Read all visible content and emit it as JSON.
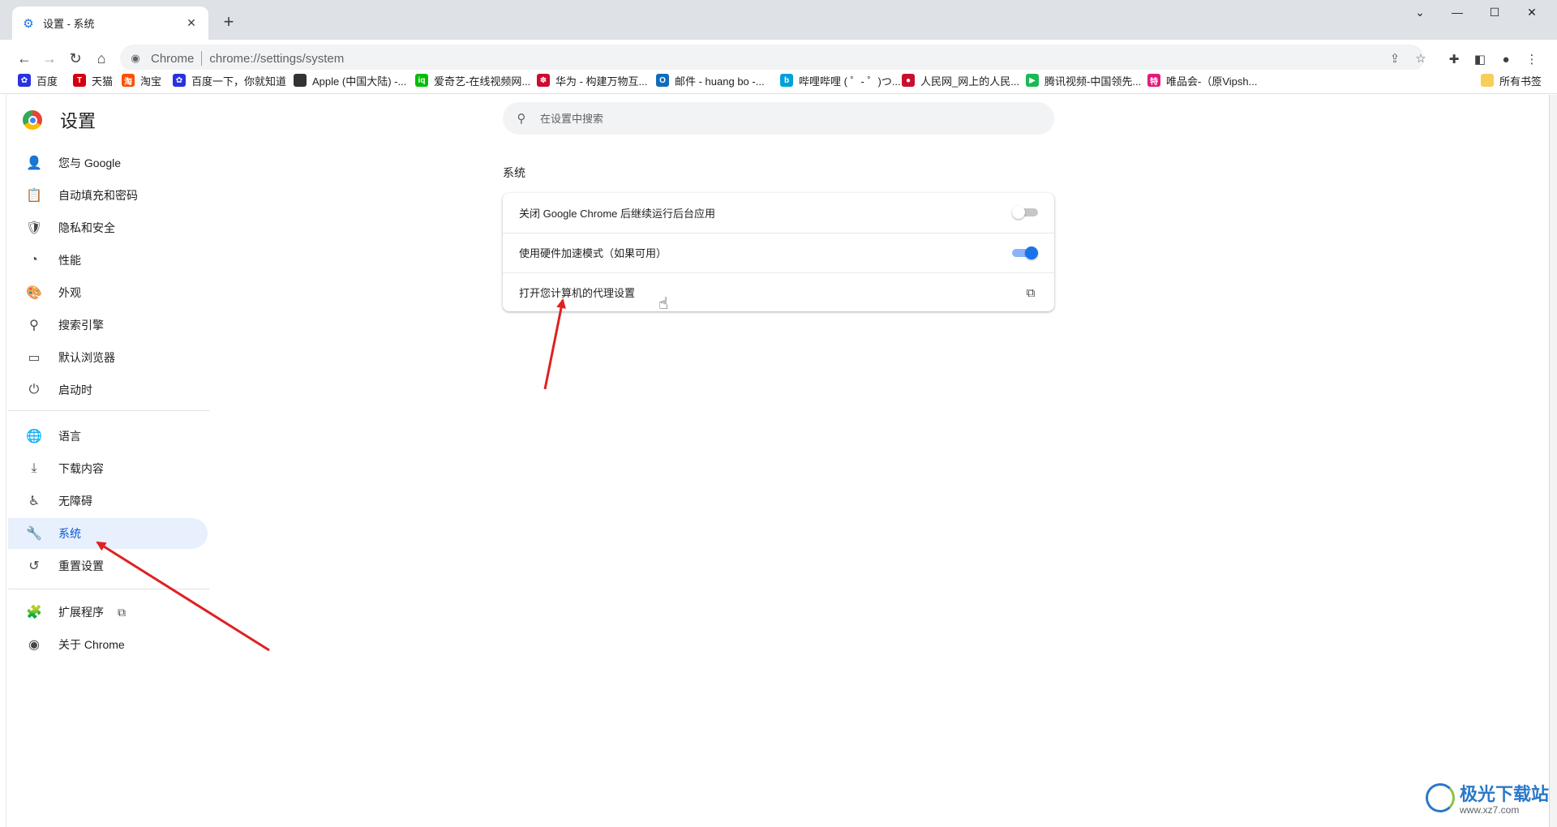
{
  "browser": {
    "tab_title": "设置 - 系统",
    "new_tab": "+",
    "omnibox_label": "Chrome",
    "url": "chrome://settings/system"
  },
  "bookmarks": [
    {
      "label": "百度",
      "color": "#2932e1",
      "glyph": "✿"
    },
    {
      "label": "天猫",
      "color": "#d4000f",
      "glyph": "T"
    },
    {
      "label": "淘宝",
      "color": "#ff5000",
      "glyph": "淘"
    },
    {
      "label": "百度一下，你就知道",
      "color": "#2932e1",
      "glyph": "✿"
    },
    {
      "label": "Apple (中国大陆) -...",
      "color": "#333333",
      "glyph": ""
    },
    {
      "label": "爱奇艺-在线视频网...",
      "color": "#00be06",
      "glyph": "iq"
    },
    {
      "label": "华为 - 构建万物互...",
      "color": "#cf0a2c",
      "glyph": "✽"
    },
    {
      "label": "邮件 - huang bo -...",
      "color": "#0f6cbd",
      "glyph": "O"
    },
    {
      "label": "哔哩哔哩 ( ゜- ゜)つ...",
      "color": "#00a1d6",
      "glyph": "b"
    },
    {
      "label": "人民网_网上的人民...",
      "color": "#c8102e",
      "glyph": "●"
    },
    {
      "label": "腾讯视频-中国领先...",
      "color": "#19b955",
      "glyph": "▶"
    },
    {
      "label": "唯品会-（原Vipsh...",
      "color": "#e3197b",
      "glyph": "特"
    }
  ],
  "all_bookmarks": "所有书签",
  "settings": {
    "title": "设置",
    "search_placeholder": "在设置中搜索",
    "nav": [
      {
        "label": "您与 Google",
        "icon": "person-icon"
      },
      {
        "label": "自动填充和密码",
        "icon": "clipboard-icon"
      },
      {
        "label": "隐私和安全",
        "icon": "shield-icon"
      },
      {
        "label": "性能",
        "icon": "speedometer-icon"
      },
      {
        "label": "外观",
        "icon": "palette-icon"
      },
      {
        "label": "搜索引擎",
        "icon": "search-icon"
      },
      {
        "label": "默认浏览器",
        "icon": "browser-icon"
      },
      {
        "label": "启动时",
        "icon": "power-icon"
      },
      {
        "label": "语言",
        "icon": "globe-icon"
      },
      {
        "label": "下载内容",
        "icon": "download-icon"
      },
      {
        "label": "无障碍",
        "icon": "accessibility-icon"
      },
      {
        "label": "系统",
        "icon": "wrench-icon",
        "active": true
      },
      {
        "label": "重置设置",
        "icon": "history-icon"
      },
      {
        "label": "扩展程序",
        "icon": "puzzle-icon"
      },
      {
        "label": "关于 Chrome",
        "icon": "chrome-icon"
      }
    ],
    "section_title": "系统",
    "rows": [
      {
        "label": "关闭 Google Chrome 后继续运行后台应用",
        "control": "toggle",
        "on": false
      },
      {
        "label": "使用硬件加速模式（如果可用）",
        "control": "toggle",
        "on": true
      },
      {
        "label": "打开您计算机的代理设置",
        "control": "external-link"
      }
    ]
  },
  "watermark": {
    "title": "极光下载站",
    "url": "www.xz7.com"
  },
  "colors": {
    "accent": "#1a73e8",
    "active_nav_bg": "#e8f0fe",
    "annotation_arrow": "#e02020"
  }
}
